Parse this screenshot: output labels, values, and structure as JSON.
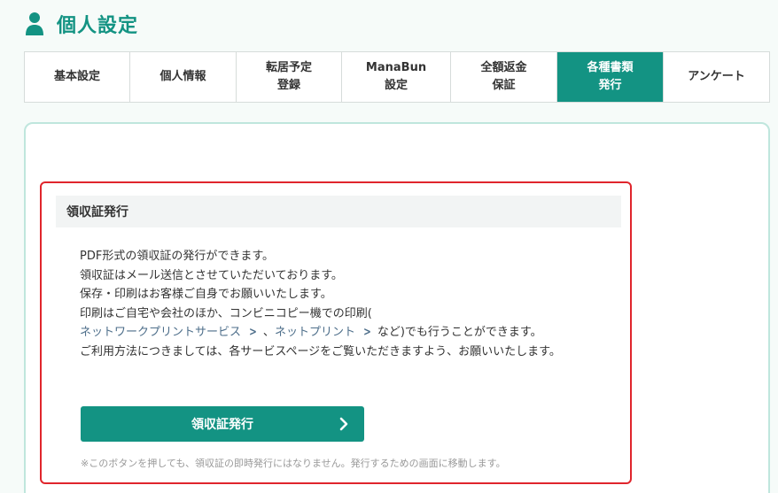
{
  "header": {
    "title": "個人設定",
    "icon": "person-icon",
    "accent_color": "#139383"
  },
  "tabs": [
    {
      "label": "基本設定",
      "active": false
    },
    {
      "label": "個人情報",
      "active": false
    },
    {
      "label": "転居予定\n登録",
      "active": false
    },
    {
      "label": "ManaBun\n設定",
      "active": false
    },
    {
      "label": "全額返金\n保証",
      "active": false
    },
    {
      "label": "各種書類\n発行",
      "active": true
    },
    {
      "label": "アンケート",
      "active": false
    }
  ],
  "receipt": {
    "title": "領収証発行",
    "lines": [
      "PDF形式の領収証の発行ができます。",
      "領収証はメール送信とさせていただいております。",
      "保存・印刷はお客様ご自身でお願いいたします。",
      "印刷はご自宅や会社のほか、コンビニコピー機での印刷("
    ],
    "link1": "ネットワークプリントサービス",
    "separator": "、",
    "link2": "ネットプリント",
    "line5_suffix": "など)でも行うことができます。",
    "line6": "ご利用方法につきましては、各サービスページをご覧いただきますよう、お願いいたします。",
    "button_label": "領収証発行",
    "note": "※このボタンを押しても、領収証の即時発行にはなりません。発行するための画面に移動します。",
    "highlight_color": "#e0252c"
  }
}
